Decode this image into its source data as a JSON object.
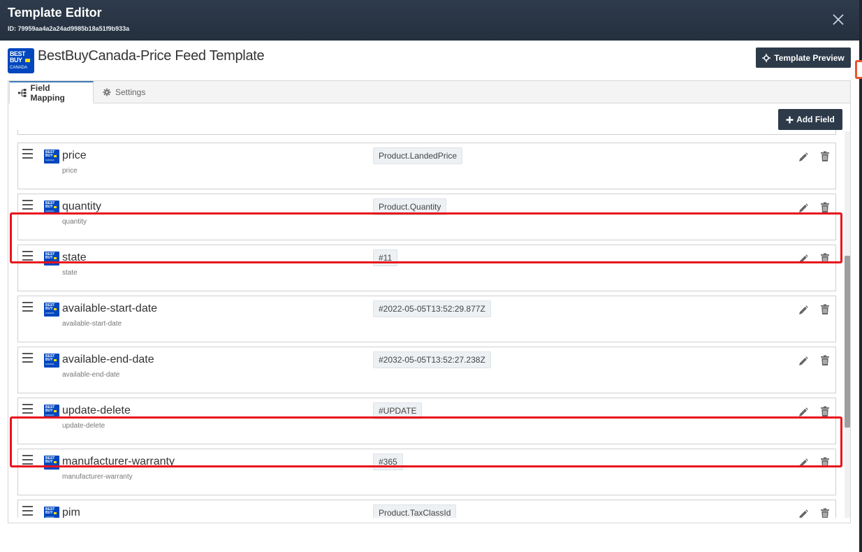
{
  "modal": {
    "title": "Template Editor",
    "id_text": "ID: 79959aa4a2a24ad9985b18a51f9b933a"
  },
  "template": {
    "logo_text_top": "BEST BUY",
    "logo_text_bottom": "CANADA",
    "name": "BestBuyCanada-Price Feed Template",
    "preview_label": "Template Preview"
  },
  "tabs": [
    {
      "label": "Field Mapping",
      "icon": "sitemap-icon",
      "active": true
    },
    {
      "label": "Settings",
      "icon": "gear-icon",
      "active": false
    }
  ],
  "toolbar": {
    "add_field_label": "Add Field"
  },
  "fields": [
    {
      "name": "price",
      "sub": "price",
      "mapping": "Product.LandedPrice",
      "highlighted": false
    },
    {
      "name": "quantity",
      "sub": "quantity",
      "mapping": "Product.Quantity",
      "highlighted": false
    },
    {
      "name": "state",
      "sub": "state",
      "mapping": "#11",
      "highlighted": true
    },
    {
      "name": "available-start-date",
      "sub": "available-start-date",
      "mapping": "#2022-05-05T13:52:29.877Z",
      "highlighted": false
    },
    {
      "name": "available-end-date",
      "sub": "available-end-date",
      "mapping": "#2032-05-05T13:52:27.238Z",
      "highlighted": false
    },
    {
      "name": "update-delete",
      "sub": "update-delete",
      "mapping": "#UPDATE",
      "highlighted": false
    },
    {
      "name": "manufacturer-warranty",
      "sub": "manufacturer-warranty",
      "mapping": "#365",
      "highlighted": true
    },
    {
      "name": "pim",
      "sub": "pim",
      "mapping": "Product.TaxClassId",
      "highlighted": false
    }
  ],
  "colors": {
    "header_bg": "#2e3b4c",
    "button_bg": "#2d3a4a",
    "brand_blue": "#0046be",
    "brand_yellow": "#ffe000",
    "highlight_red": "#e8131c",
    "active_tab_accent": "#3d7ab8"
  }
}
